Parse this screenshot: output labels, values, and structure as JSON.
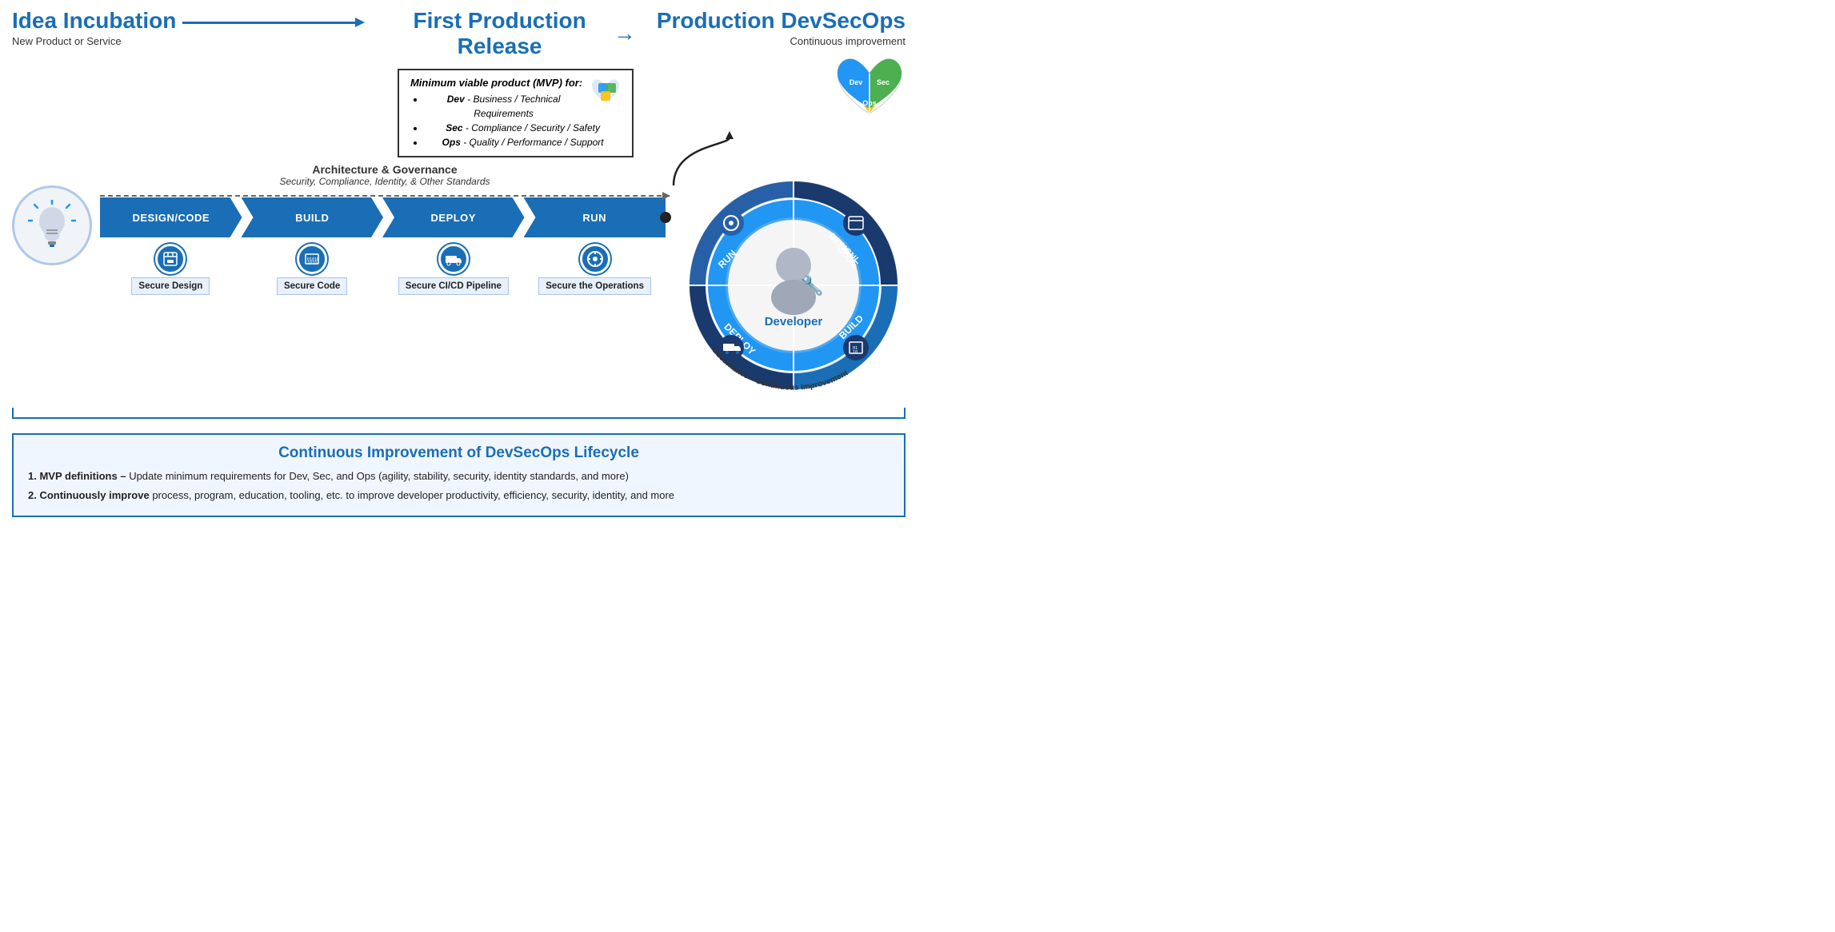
{
  "header": {
    "idea_title": "Idea Incubation",
    "idea_arrow": "→",
    "idea_subtitle": "New Product or Service",
    "first_production_title": "First Production Release",
    "fp_arrow": "→",
    "production_title": "Production DevSecOps",
    "production_subtitle": "Continuous improvement"
  },
  "mvp_box": {
    "title": "Minimum viable product (MVP) for:",
    "items": [
      {
        "bold": "Dev",
        "rest": " - Business / Technical Requirements"
      },
      {
        "bold": "Sec",
        "rest": " - Compliance / Security / Safety"
      },
      {
        "bold": "Ops",
        "rest": " - Quality / Performance / Support"
      }
    ]
  },
  "arch_gov": {
    "title": "Architecture & Governance",
    "subtitle": "Security, Compliance, Identity, & Other Standards"
  },
  "pipeline": {
    "segments": [
      "DESIGN/CODE",
      "BUILD",
      "DEPLOY",
      "RUN"
    ],
    "icons": [
      "⊞",
      "⬛",
      "🚛",
      "⚙"
    ],
    "labels": [
      "Secure Design",
      "Secure Code",
      "Secure CI/CD Pipeline",
      "Secure the Operations"
    ]
  },
  "circle_diagram": {
    "segments": [
      "DESIGN/CODE",
      "BUILD",
      "DEPLOY",
      "RUN"
    ],
    "center_label": "Developer",
    "outer_label": "Governance – Continuous Improvement"
  },
  "bottom": {
    "title": "Continuous Improvement of DevSecOps Lifecycle",
    "item1_bold": "1.  MVP definitions –",
    "item1_rest": " Update minimum requirements for Dev, Sec, and Ops (agility, stability, security, identity standards, and more)",
    "item2_bold": "2.  Continuously improve",
    "item2_rest": " process, program, education, tooling, etc. to improve developer productivity, efficiency, security, identity, and more"
  }
}
